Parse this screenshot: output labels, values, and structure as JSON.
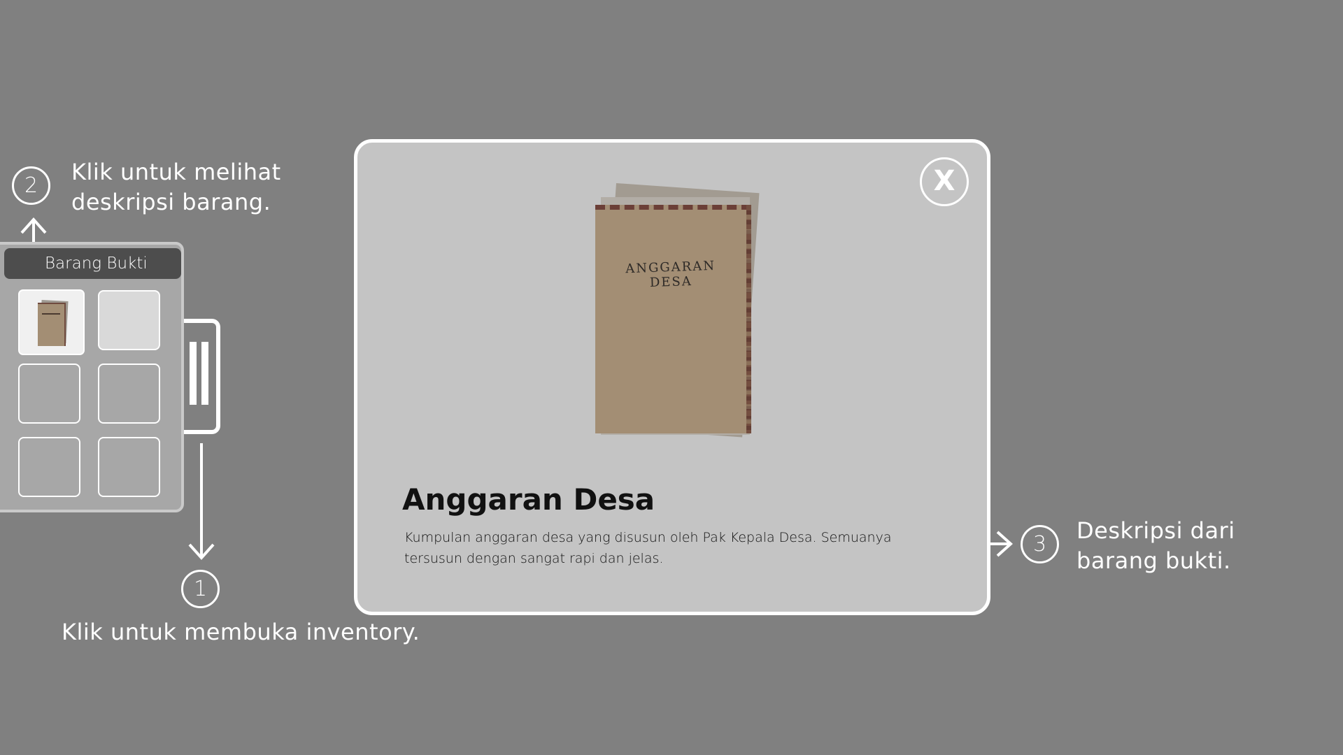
{
  "inventory": {
    "title": "Barang Bukti",
    "slots": [
      {
        "filled": true,
        "item_icon": "document-book-icon"
      },
      {
        "filled": false
      },
      {
        "filled": false
      },
      {
        "filled": false
      },
      {
        "filled": false
      },
      {
        "filled": false
      }
    ],
    "toggle_icon": "pause-bars-icon"
  },
  "tutorial": {
    "step1": {
      "number": "1",
      "text": "Klik untuk membuka inventory."
    },
    "step2": {
      "number": "2",
      "line1": "Klik untuk melihat",
      "line2": "deskripsi barang."
    },
    "step3": {
      "number": "3",
      "line1": "Deskripsi dari",
      "line2": "barang bukti."
    }
  },
  "modal": {
    "close_label": "X",
    "book_cover_text": "ANGGARAN DESA",
    "item_name": "Anggaran Desa",
    "item_description": "Kumpulan anggaran desa yang disusun oleh Pak Kepala Desa. Semuanya tersusun dengan sangat rapi dan jelas."
  },
  "colors": {
    "background": "#808080",
    "modal_bg": "#c4c4c4",
    "inventory_bg": "#a7a7a7",
    "inventory_header": "#4d4d4d",
    "book_cover": "#a38e74",
    "book_border": "#6b3f37"
  }
}
